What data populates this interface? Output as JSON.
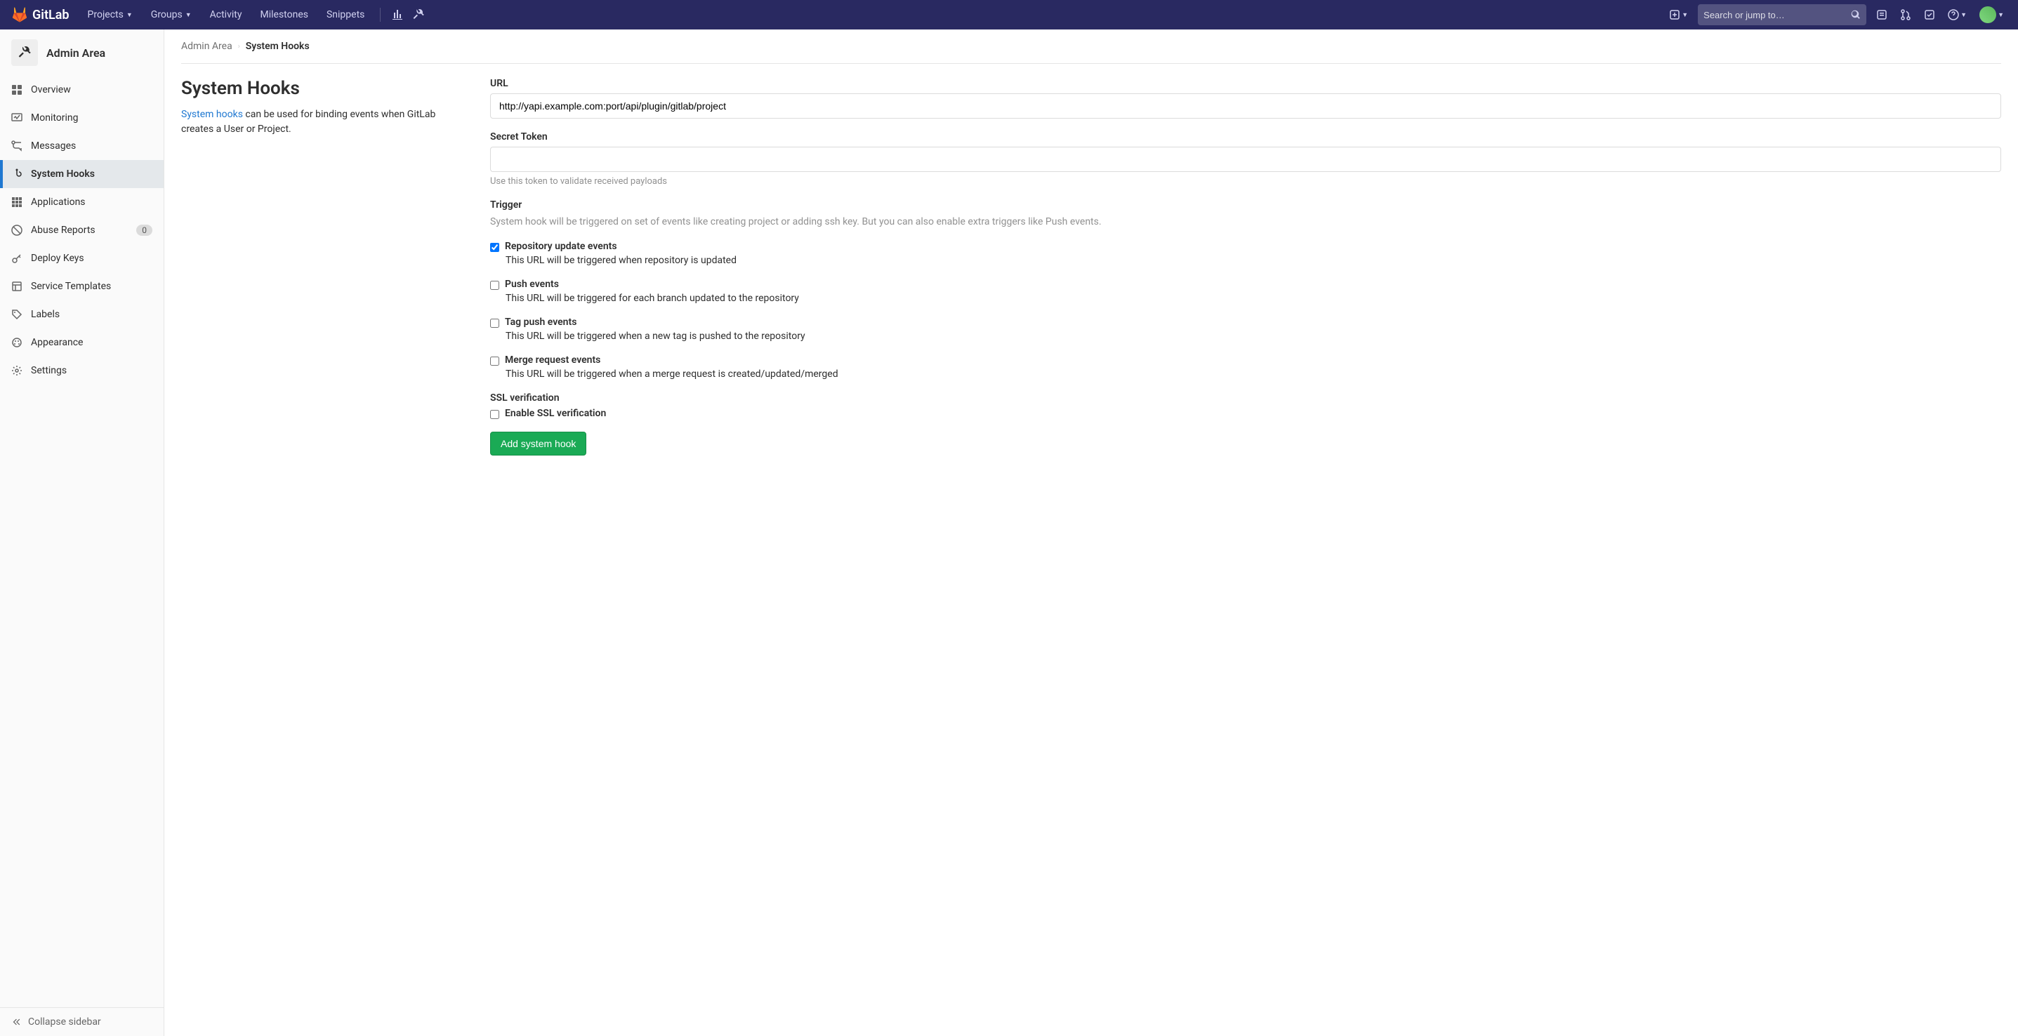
{
  "navbar": {
    "brand": "GitLab",
    "projects": "Projects",
    "groups": "Groups",
    "activity": "Activity",
    "milestones": "Milestones",
    "snippets": "Snippets",
    "search_placeholder": "Search or jump to…"
  },
  "sidebar": {
    "title": "Admin Area",
    "items": [
      {
        "label": "Overview",
        "icon": "overview"
      },
      {
        "label": "Monitoring",
        "icon": "monitoring"
      },
      {
        "label": "Messages",
        "icon": "messages"
      },
      {
        "label": "System Hooks",
        "icon": "hook",
        "active": true
      },
      {
        "label": "Applications",
        "icon": "applications"
      },
      {
        "label": "Abuse Reports",
        "icon": "abuse",
        "badge": "0"
      },
      {
        "label": "Deploy Keys",
        "icon": "key"
      },
      {
        "label": "Service Templates",
        "icon": "template"
      },
      {
        "label": "Labels",
        "icon": "labels"
      },
      {
        "label": "Appearance",
        "icon": "appearance"
      },
      {
        "label": "Settings",
        "icon": "settings"
      }
    ],
    "collapse": "Collapse sidebar"
  },
  "breadcrumb": {
    "parent": "Admin Area",
    "current": "System Hooks"
  },
  "page": {
    "title": "System Hooks",
    "desc_link": "System hooks",
    "desc_rest": " can be used for binding events when GitLab creates a User or Project."
  },
  "form": {
    "url_label": "URL",
    "url_value": "http://yapi.example.com:port/api/plugin/gitlab/project",
    "secret_label": "Secret Token",
    "secret_value": "",
    "secret_help": "Use this token to validate received payloads",
    "trigger_label": "Trigger",
    "trigger_desc": "System hook will be triggered on set of events like creating project or adding ssh key. But you can also enable extra triggers like Push events.",
    "triggers": [
      {
        "label": "Repository update events",
        "desc": "This URL will be triggered when repository is updated",
        "checked": true
      },
      {
        "label": "Push events",
        "desc": "This URL will be triggered for each branch updated to the repository",
        "checked": false
      },
      {
        "label": "Tag push events",
        "desc": "This URL will be triggered when a new tag is pushed to the repository",
        "checked": false
      },
      {
        "label": "Merge request events",
        "desc": "This URL will be triggered when a merge request is created/updated/merged",
        "checked": false
      }
    ],
    "ssl_label": "SSL verification",
    "ssl_checkbox": "Enable SSL verification",
    "ssl_checked": false,
    "submit": "Add system hook"
  }
}
